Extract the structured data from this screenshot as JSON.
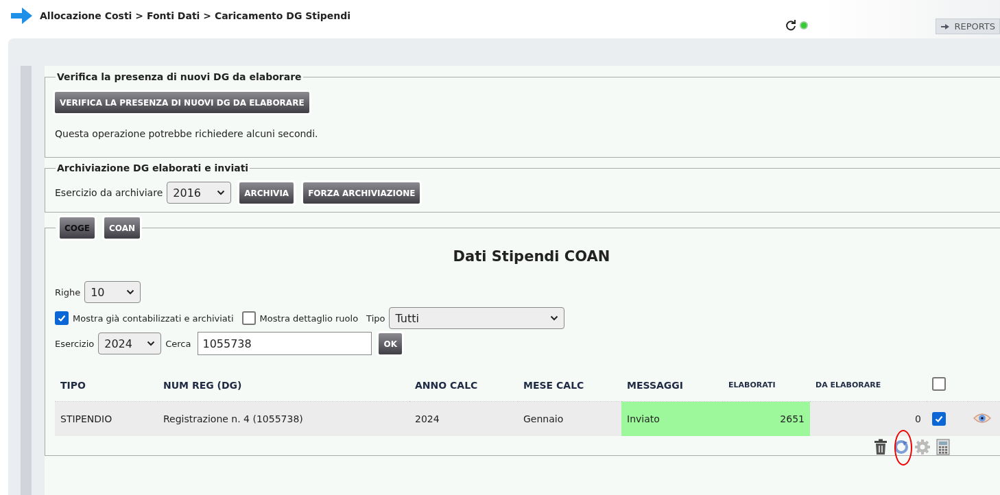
{
  "breadcrumb": "Allocazione Costi > Fonti Dati > Caricamento DG Stipendi",
  "status": {
    "online": true
  },
  "top_links": [
    {
      "label": "REPORTS"
    }
  ],
  "check_section": {
    "legend": "Verifica la presenza di nuovi DG da elaborare",
    "button": "VERIFICA LA PRESENZA DI NUOVI DG DA ELABORARE",
    "note": "Questa operazione potrebbe richiedere alcuni secondi."
  },
  "archive_section": {
    "legend": "Archiviazione DG elaborati e inviati",
    "year_label": "Esercizio da archiviare",
    "year": "2016",
    "buttons": [
      "ARCHIVIA",
      "FORZA ARCHIVIAZIONE"
    ]
  },
  "tabs": [
    {
      "label": "COGE",
      "selected": false
    },
    {
      "label": "COAN",
      "selected": true
    }
  ],
  "data_section": {
    "title": "Dati Stipendi COAN",
    "rows_label": "Righe",
    "rows": "10",
    "filters": [
      {
        "label": "Mostra già contabilizzati e archiviati",
        "checked": true
      },
      {
        "label": "Mostra dettaglio ruolo",
        "checked": false
      }
    ],
    "type_label": "Tipo",
    "type": "Tutti",
    "year_label": "Esercizio",
    "year": "2024",
    "search_label": "Cerca",
    "search": "1055738",
    "ok": "OK"
  },
  "table": {
    "columns": [
      "TIPO",
      "NUM REG (DG)",
      "ANNO CALC",
      "MESE CALC",
      "MESSAGGI",
      "ELABORATI",
      "DA ELABORARE"
    ],
    "select_all": false,
    "rows": [
      {
        "cells": [
          "STIPENDIO",
          "Registrazione n. 4 (1055738)",
          "2024",
          "Gennaio",
          "Inviato",
          "2651",
          "0"
        ],
        "checked": true,
        "highlighted": true
      }
    ]
  }
}
